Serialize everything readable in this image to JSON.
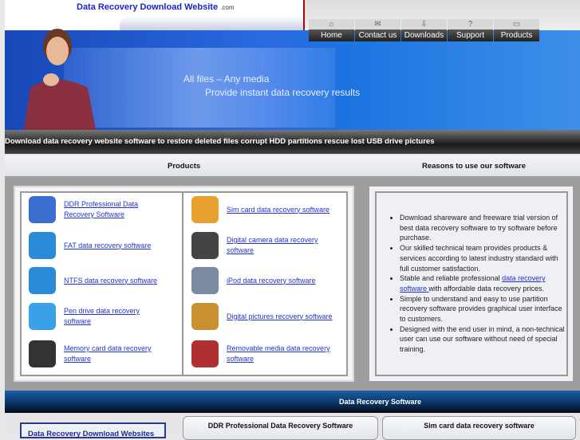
{
  "header": {
    "logo_main": "Data Recovery Download Website",
    "logo_suffix": ".com"
  },
  "nav": [
    {
      "label": "Home",
      "icon": "home-icon"
    },
    {
      "label": "Contact us",
      "icon": "envelope-icon"
    },
    {
      "label": "Downloads",
      "icon": "download-icon"
    },
    {
      "label": "Support",
      "icon": "question-icon"
    },
    {
      "label": "Products",
      "icon": "box-icon"
    }
  ],
  "banner": {
    "line1": "All files – Any media",
    "line2": "Provide instant data recovery results"
  },
  "tagline": "Download data recovery website software to restore deleted files corrupt HDD partitions rescue lost USB drive pictures",
  "columns": {
    "products": "Products",
    "reasons": "Reasons to use our software"
  },
  "products_left": [
    {
      "label": "DDR Professional Data Recovery Software",
      "icon": "ddr-professional-icon",
      "color": "#3a6fd0"
    },
    {
      "label": "FAT data recovery software",
      "icon": "fat-icon",
      "color": "#2a8ad8"
    },
    {
      "label": "NTFS data recovery software",
      "icon": "ntfs-icon",
      "color": "#2a8ad8"
    },
    {
      "label": "Pen drive data recovery software",
      "icon": "pen-drive-icon",
      "color": "#3aa0e8"
    },
    {
      "label": "Memory card data recovery software",
      "icon": "memory-card-icon",
      "color": "#333333"
    }
  ],
  "products_right": [
    {
      "label": "Sim card data recovery software",
      "icon": "sim-card-icon",
      "color": "#e8a030"
    },
    {
      "label": "Digital camera data recovery software",
      "icon": "camera-icon",
      "color": "#444444"
    },
    {
      "label": "iPod data recovery software",
      "icon": "ipod-icon",
      "color": "#7a8aa0"
    },
    {
      "label": "Digital pictures recovery software",
      "icon": "pictures-icon",
      "color": "#c89030"
    },
    {
      "label": "Removable media data recovery software",
      "icon": "removable-media-icon",
      "color": "#b03030"
    }
  ],
  "reasons": {
    "r1": "Download shareware and freeware trial version of best data recovery software to try software before purchase.",
    "r2": "Our skilled technical team provides products & services according to latest industry standard with full customer satisfaction.",
    "r3_pre": "Stable and reliable professional ",
    "r3_link": "data recovery software ",
    "r3_post": "with affordable data recovery prices.",
    "r4": "Simple to understand and easy to use partition recovery software provides graphical user interface to customers.",
    "r5": "Designed with the end user in mind, a non-technical user can use our software without need of special training."
  },
  "section_title": "Data Recovery Software",
  "bottom": {
    "sites_box": "Data Recovery Download Websites",
    "card1": "DDR Professional Data Recovery Software",
    "card2": "Sim card data recovery software"
  }
}
